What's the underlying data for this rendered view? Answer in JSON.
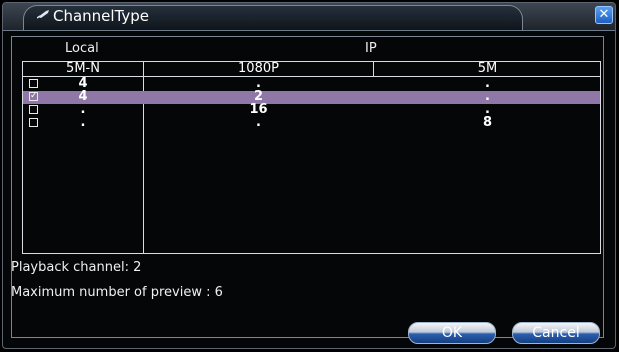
{
  "window": {
    "title": "ChannelType",
    "close_glyph": "✕"
  },
  "sections": {
    "local": "Local",
    "ip": "IP"
  },
  "columns": [
    "5M-N",
    "1080P",
    "5M"
  ],
  "rows": [
    {
      "checked": false,
      "selected": false,
      "cells": [
        "4",
        ".",
        "."
      ]
    },
    {
      "checked": true,
      "selected": true,
      "cells": [
        "4",
        "2",
        "."
      ]
    },
    {
      "checked": false,
      "selected": false,
      "cells": [
        ".",
        "16",
        "."
      ]
    },
    {
      "checked": false,
      "selected": false,
      "cells": [
        ".",
        ".",
        "8"
      ]
    }
  ],
  "info": {
    "playback": "Playback channel: 2",
    "preview": "Maximum number of preview   : 6"
  },
  "buttons": {
    "ok": "OK",
    "cancel": "Cancel"
  },
  "colors": {
    "selected_row": "#8f78a8",
    "frame": "#7b8592"
  }
}
